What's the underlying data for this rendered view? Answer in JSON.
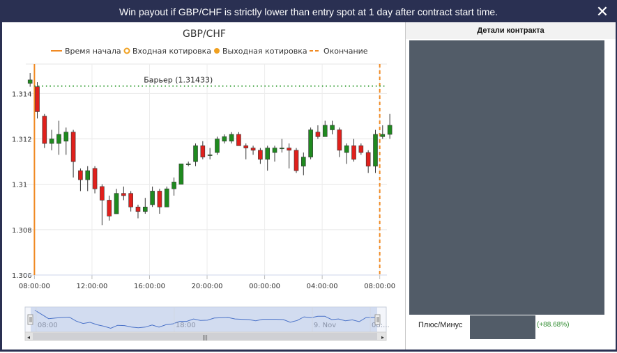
{
  "dialog": {
    "title": "Win payout if GBP/CHF is strictly lower than entry spot at 1 day after contract start time.",
    "close_glyph": "✕"
  },
  "chart_data": {
    "type": "candlestick",
    "title": "GBP/CHF",
    "legend": [
      {
        "label": "Время начала",
        "symbol": "solid-line",
        "color": "#f08a24"
      },
      {
        "label": "Входная котировка",
        "symbol": "hollow-circle",
        "color": "#f0a020"
      },
      {
        "label": "Выходная котировка",
        "symbol": "filled-circle",
        "color": "#f0a020"
      },
      {
        "label": "Окончание",
        "symbol": "dashed-line",
        "color": "#f08a24"
      }
    ],
    "legend_position": "top",
    "barrier": {
      "label": "Барьер (1.31433)",
      "value": 1.31433,
      "color": "#2e9b2e"
    },
    "y_ticks": [
      "1.306",
      "1.308",
      "1.31",
      "1.312",
      "1.314"
    ],
    "y_tick_values": [
      1.306,
      1.308,
      1.31,
      1.312,
      1.314
    ],
    "ylim": [
      1.306,
      1.3153
    ],
    "x_ticks": [
      "08:00:00",
      "12:00:00",
      "16:00:00",
      "20:00:00",
      "00:00:00",
      "04:00:00",
      "08:00:00"
    ],
    "x_tick_hours": [
      0,
      4,
      8,
      12,
      16,
      20,
      24
    ],
    "x_range_hours": [
      -0.6,
      24.5
    ],
    "start_time_hour": 0,
    "end_time_hour": 24,
    "grid": true,
    "candles": [
      {
        "h": -0.3,
        "o": 1.31445,
        "c": 1.3146,
        "hi": 1.3149,
        "lo": 1.3143
      },
      {
        "h": 0.2,
        "o": 1.3143,
        "c": 1.3132,
        "hi": 1.3145,
        "lo": 1.3129
      },
      {
        "h": 0.7,
        "o": 1.313,
        "c": 1.3118,
        "hi": 1.3131,
        "lo": 1.3116
      },
      {
        "h": 1.2,
        "o": 1.3118,
        "c": 1.312,
        "hi": 1.3124,
        "lo": 1.3115
      },
      {
        "h": 1.7,
        "o": 1.3118,
        "c": 1.3122,
        "hi": 1.3128,
        "lo": 1.3113
      },
      {
        "h": 2.2,
        "o": 1.3119,
        "c": 1.3123,
        "hi": 1.3125,
        "lo": 1.3113
      },
      {
        "h": 2.7,
        "o": 1.3123,
        "c": 1.311,
        "hi": 1.3124,
        "lo": 1.3103
      },
      {
        "h": 3.2,
        "o": 1.3106,
        "c": 1.3102,
        "hi": 1.3107,
        "lo": 1.3097
      },
      {
        "h": 3.7,
        "o": 1.3102,
        "c": 1.3106,
        "hi": 1.3108,
        "lo": 1.3097
      },
      {
        "h": 4.2,
        "o": 1.3107,
        "c": 1.3098,
        "hi": 1.3108,
        "lo": 1.3096
      },
      {
        "h": 4.7,
        "o": 1.3099,
        "c": 1.3093,
        "hi": 1.31,
        "lo": 1.3082
      },
      {
        "h": 5.2,
        "o": 1.3093,
        "c": 1.3086,
        "hi": 1.3095,
        "lo": 1.3084
      },
      {
        "h": 5.7,
        "o": 1.3087,
        "c": 1.3096,
        "hi": 1.3098,
        "lo": 1.3087
      },
      {
        "h": 6.2,
        "o": 1.3096,
        "c": 1.3095,
        "hi": 1.3099,
        "lo": 1.3093
      },
      {
        "h": 6.7,
        "o": 1.3096,
        "c": 1.309,
        "hi": 1.3097,
        "lo": 1.3088
      },
      {
        "h": 7.2,
        "o": 1.309,
        "c": 1.3088,
        "hi": 1.3091,
        "lo": 1.3085
      },
      {
        "h": 7.7,
        "o": 1.3088,
        "c": 1.309,
        "hi": 1.3094,
        "lo": 1.3087
      },
      {
        "h": 8.2,
        "o": 1.3091,
        "c": 1.3097,
        "hi": 1.3099,
        "lo": 1.309
      },
      {
        "h": 8.7,
        "o": 1.3097,
        "c": 1.309,
        "hi": 1.3098,
        "lo": 1.3087
      },
      {
        "h": 9.2,
        "o": 1.309,
        "c": 1.3098,
        "hi": 1.3099,
        "lo": 1.309
      },
      {
        "h": 9.7,
        "o": 1.3098,
        "c": 1.3101,
        "hi": 1.3103,
        "lo": 1.3095
      },
      {
        "h": 10.2,
        "o": 1.31,
        "c": 1.3109,
        "hi": 1.3109,
        "lo": 1.31
      },
      {
        "h": 10.7,
        "o": 1.3109,
        "c": 1.3109,
        "hi": 1.311,
        "lo": 1.3108
      },
      {
        "h": 11.2,
        "o": 1.311,
        "c": 1.3117,
        "hi": 1.3118,
        "lo": 1.3108
      },
      {
        "h": 11.7,
        "o": 1.3117,
        "c": 1.3112,
        "hi": 1.3119,
        "lo": 1.3111
      },
      {
        "h": 12.2,
        "o": 1.3113,
        "c": 1.3113,
        "hi": 1.3116,
        "lo": 1.3111
      },
      {
        "h": 12.7,
        "o": 1.3114,
        "c": 1.312,
        "hi": 1.3121,
        "lo": 1.3113
      },
      {
        "h": 13.2,
        "o": 1.3119,
        "c": 1.3121,
        "hi": 1.3122,
        "lo": 1.3118
      },
      {
        "h": 13.7,
        "o": 1.3119,
        "c": 1.3122,
        "hi": 1.3123,
        "lo": 1.3118
      },
      {
        "h": 14.2,
        "o": 1.3122,
        "c": 1.3117,
        "hi": 1.3123,
        "lo": 1.3117
      },
      {
        "h": 14.7,
        "o": 1.3117,
        "c": 1.3116,
        "hi": 1.3118,
        "lo": 1.3111
      },
      {
        "h": 15.2,
        "o": 1.3116,
        "c": 1.3115,
        "hi": 1.3117,
        "lo": 1.3113
      },
      {
        "h": 15.7,
        "o": 1.3115,
        "c": 1.3111,
        "hi": 1.3116,
        "lo": 1.3109
      },
      {
        "h": 16.2,
        "o": 1.3111,
        "c": 1.3116,
        "hi": 1.3117,
        "lo": 1.3106
      },
      {
        "h": 16.7,
        "o": 1.3114,
        "c": 1.3116,
        "hi": 1.3117,
        "lo": 1.311
      },
      {
        "h": 17.2,
        "o": 1.3116,
        "c": 1.3116,
        "hi": 1.312,
        "lo": 1.3114
      },
      {
        "h": 17.7,
        "o": 1.3116,
        "c": 1.3115,
        "hi": 1.3118,
        "lo": 1.3107
      },
      {
        "h": 18.2,
        "o": 1.3115,
        "c": 1.3106,
        "hi": 1.3116,
        "lo": 1.3105
      },
      {
        "h": 18.7,
        "o": 1.3108,
        "c": 1.3112,
        "hi": 1.3114,
        "lo": 1.3104
      },
      {
        "h": 19.2,
        "o": 1.3112,
        "c": 1.3124,
        "hi": 1.3125,
        "lo": 1.3111
      },
      {
        "h": 19.7,
        "o": 1.3123,
        "c": 1.3121,
        "hi": 1.3126,
        "lo": 1.312
      },
      {
        "h": 20.2,
        "o": 1.3121,
        "c": 1.3126,
        "hi": 1.3128,
        "lo": 1.3121
      },
      {
        "h": 20.7,
        "o": 1.3124,
        "c": 1.3126,
        "hi": 1.3128,
        "lo": 1.3122
      },
      {
        "h": 21.2,
        "o": 1.3124,
        "c": 1.3115,
        "hi": 1.3125,
        "lo": 1.3112
      },
      {
        "h": 21.7,
        "o": 1.3114,
        "c": 1.3117,
        "hi": 1.3118,
        "lo": 1.3109
      },
      {
        "h": 22.2,
        "o": 1.3117,
        "c": 1.3111,
        "hi": 1.312,
        "lo": 1.311
      },
      {
        "h": 22.7,
        "o": 1.3117,
        "c": 1.3114,
        "hi": 1.3118,
        "lo": 1.3113
      },
      {
        "h": 23.2,
        "o": 1.3114,
        "c": 1.3108,
        "hi": 1.3115,
        "lo": 1.3105
      },
      {
        "h": 23.7,
        "o": 1.3108,
        "c": 1.3122,
        "hi": 1.3124,
        "lo": 1.3105
      },
      {
        "h": 24.2,
        "o": 1.3121,
        "c": 1.3122,
        "hi": 1.3126,
        "lo": 1.312
      },
      {
        "h": 24.7,
        "o": 1.3122,
        "c": 1.3126,
        "hi": 1.3131,
        "lo": 1.312
      }
    ],
    "up_color": "#1f8a1f",
    "down_color": "#e0201c",
    "navigator": {
      "labels": [
        "08:00",
        "18:00",
        "9. Nov",
        "08:..."
      ],
      "label_hours": [
        0,
        10,
        20,
        24.2
      ]
    }
  },
  "side_panel": {
    "header": "Детали контракта",
    "plus_minus_label": "Плюс/Минус",
    "plus_minus_value": "(+88.68%)"
  }
}
